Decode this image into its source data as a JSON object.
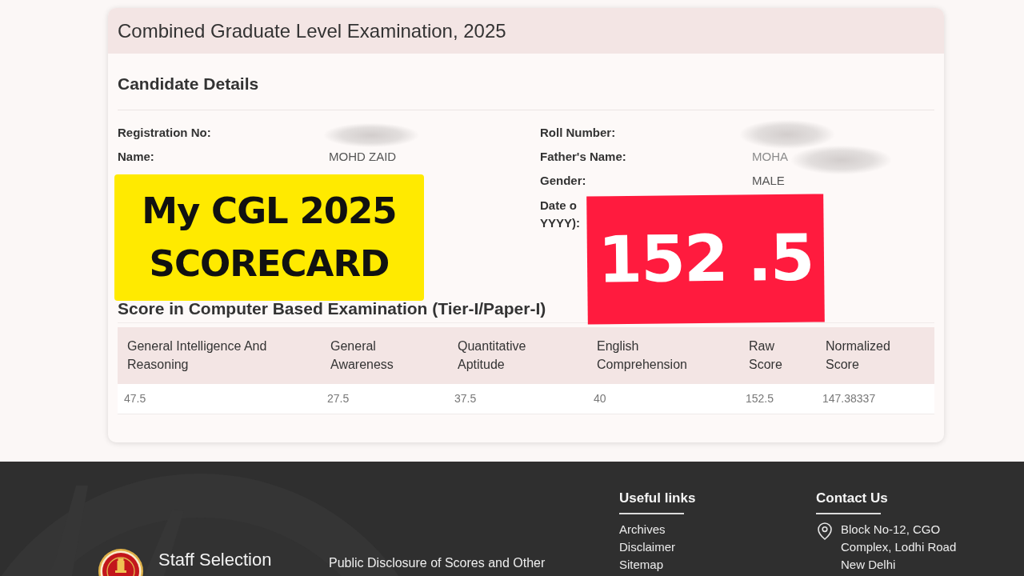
{
  "card": {
    "title": "Combined Graduate Level Examination, 2025"
  },
  "candidate_details": {
    "heading": "Candidate Details",
    "left": [
      {
        "label": "Registration No:",
        "kind": "redacted"
      },
      {
        "label": "Name:",
        "kind": "text",
        "value": "MOHD ZAID"
      }
    ],
    "right": [
      {
        "label": "Roll Number:",
        "kind": "redacted"
      },
      {
        "label": "Father's Name:",
        "kind": "partly_redacted",
        "value": "MOHA"
      },
      {
        "label": "Gender:",
        "kind": "text",
        "value": "MALE"
      },
      {
        "label_lines": [
          "Date o",
          "YYYY):"
        ],
        "kind": "covered"
      }
    ]
  },
  "score": {
    "heading": "Score in Computer Based Examination (Tier-I/Paper-I)",
    "table": {
      "columns": [
        "General Intelligence And Reasoning",
        "General Awareness",
        "Quantitative Aptitude",
        "English Comprehension",
        "Raw Score",
        "Normalized Score"
      ],
      "rows": [
        [
          "47.5",
          "27.5",
          "37.5",
          "40",
          "152.5",
          "147.38337"
        ]
      ]
    }
  },
  "footer": {
    "org_name": "Staff Selection",
    "disclosure_link": "Public Disclosure of Scores and Other",
    "useful_links": {
      "heading": "Useful links",
      "links": [
        "Archives",
        "Disclaimer",
        "Sitemap"
      ]
    },
    "contact": {
      "heading": "Contact Us",
      "address_lines": [
        "Block No-12, CGO",
        "Complex, Lodhi Road",
        "New Delhi"
      ]
    }
  },
  "overlays": [
    {
      "kind": "yellow_note",
      "lines": [
        "My CGL 2025",
        "SCORECARD"
      ]
    },
    {
      "kind": "red_note",
      "lines": [
        "152 .5"
      ]
    }
  ]
}
